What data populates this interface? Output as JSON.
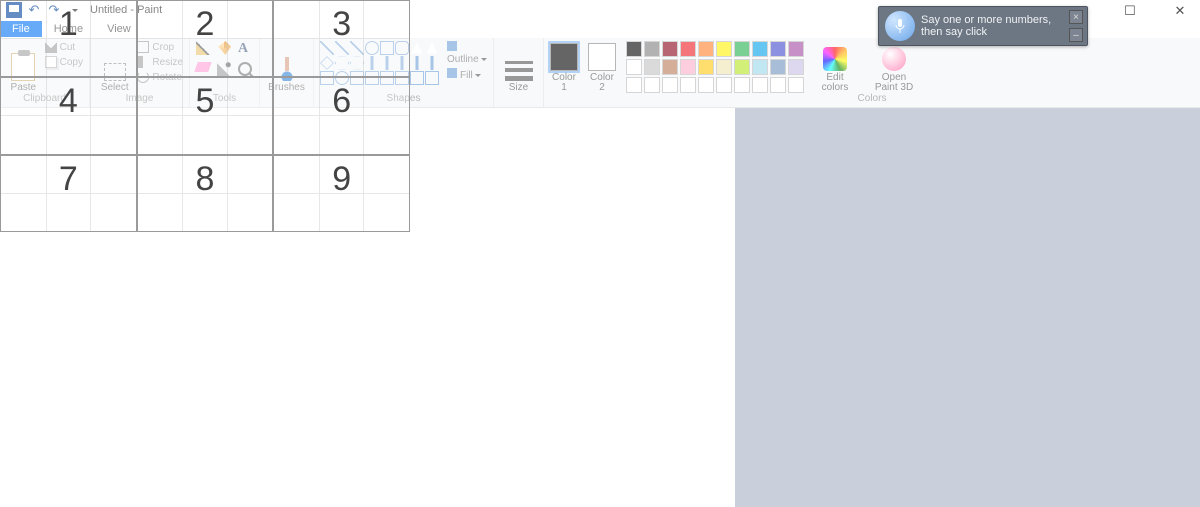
{
  "window": {
    "title": "Untitled - Paint"
  },
  "qat": {
    "save": "save-icon",
    "undo": "↶",
    "redo": "↷"
  },
  "tabs": {
    "file": "File",
    "home": "Home",
    "view": "View"
  },
  "ribbon": {
    "clipboard": {
      "label": "Clipboard",
      "paste": "Paste",
      "cut": "Cut",
      "copy": "Copy"
    },
    "image": {
      "label": "Image",
      "select": "Select",
      "crop": "Crop",
      "resize": "Resize",
      "rotate": "Rotate"
    },
    "tools": {
      "label": "Tools"
    },
    "brushes": {
      "label": "Brushes"
    },
    "shapes": {
      "label": "Shapes",
      "outline": "Outline",
      "fill": "Fill"
    },
    "size": {
      "label": "Size"
    },
    "colors": {
      "label": "Colors",
      "color1": "Color\n1",
      "color2": "Color\n2",
      "edit": "Edit\ncolors",
      "open3d": "Open\nPaint 3D"
    }
  },
  "palette_row1": [
    "#000000",
    "#7f7f7f",
    "#880015",
    "#ed1c24",
    "#ff7f27",
    "#fff200",
    "#22b14c",
    "#00a2e8",
    "#3f48cc",
    "#a349a4"
  ],
  "palette_row2": [
    "#ffffff",
    "#c3c3c3",
    "#b97a57",
    "#ffaec9",
    "#ffc90e",
    "#efe4b0",
    "#b5e61d",
    "#99d9ea",
    "#7092be",
    "#c8bfe7"
  ],
  "palette_row3": [
    "#ffffff",
    "#ffffff",
    "#ffffff",
    "#ffffff",
    "#ffffff",
    "#ffffff",
    "#ffffff",
    "#ffffff",
    "#ffffff",
    "#ffffff"
  ],
  "color1_value": "#000000",
  "color2_value": "#ffffff",
  "speech_numbers": [
    "1",
    "2",
    "3",
    "4",
    "5",
    "6",
    "7",
    "8",
    "9"
  ],
  "speech_prompt": "Say one or more numbers, then say click",
  "win_controls": {
    "min": "—",
    "max": "☐",
    "close": "✕"
  }
}
